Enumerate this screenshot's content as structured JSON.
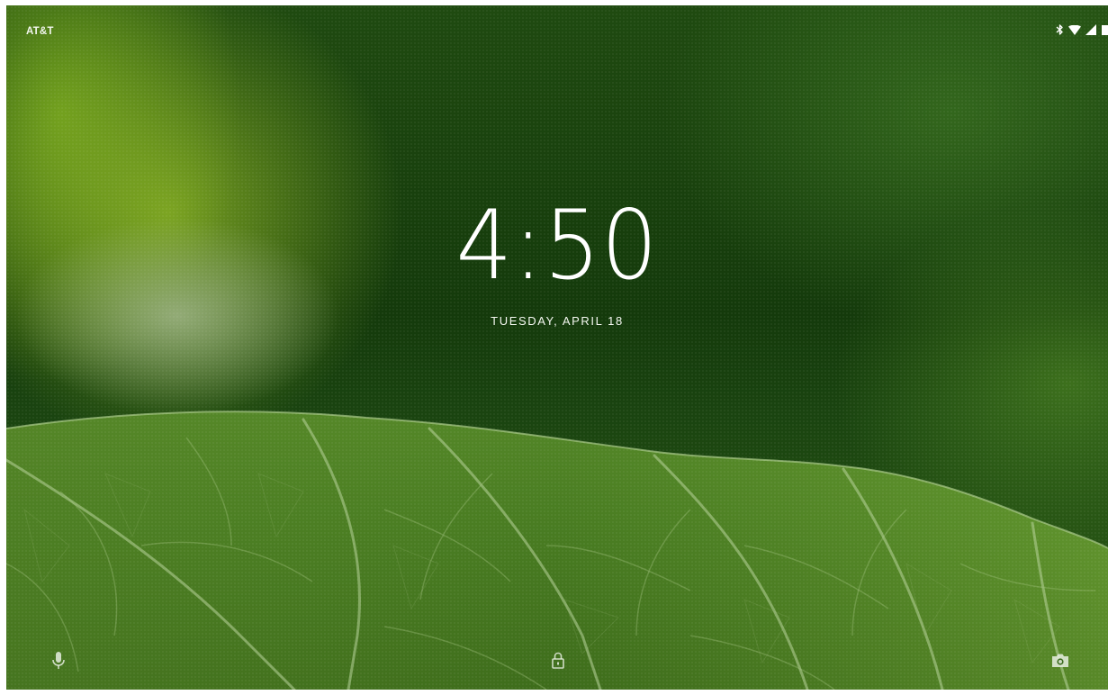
{
  "status_bar": {
    "carrier": "AT&T",
    "icons": [
      "bluetooth-icon",
      "wifi-icon",
      "cellular-signal-icon",
      "battery-icon"
    ]
  },
  "lock_screen": {
    "time": "4:50",
    "date": "TUESDAY, APRIL 18"
  },
  "bottom_actions": {
    "left": "microphone-icon",
    "center": "lock-icon",
    "right": "camera-icon"
  },
  "colors": {
    "text": "#ffffff",
    "wallpaper_dark": "#143a0b",
    "wallpaper_light": "#7fae2a"
  }
}
